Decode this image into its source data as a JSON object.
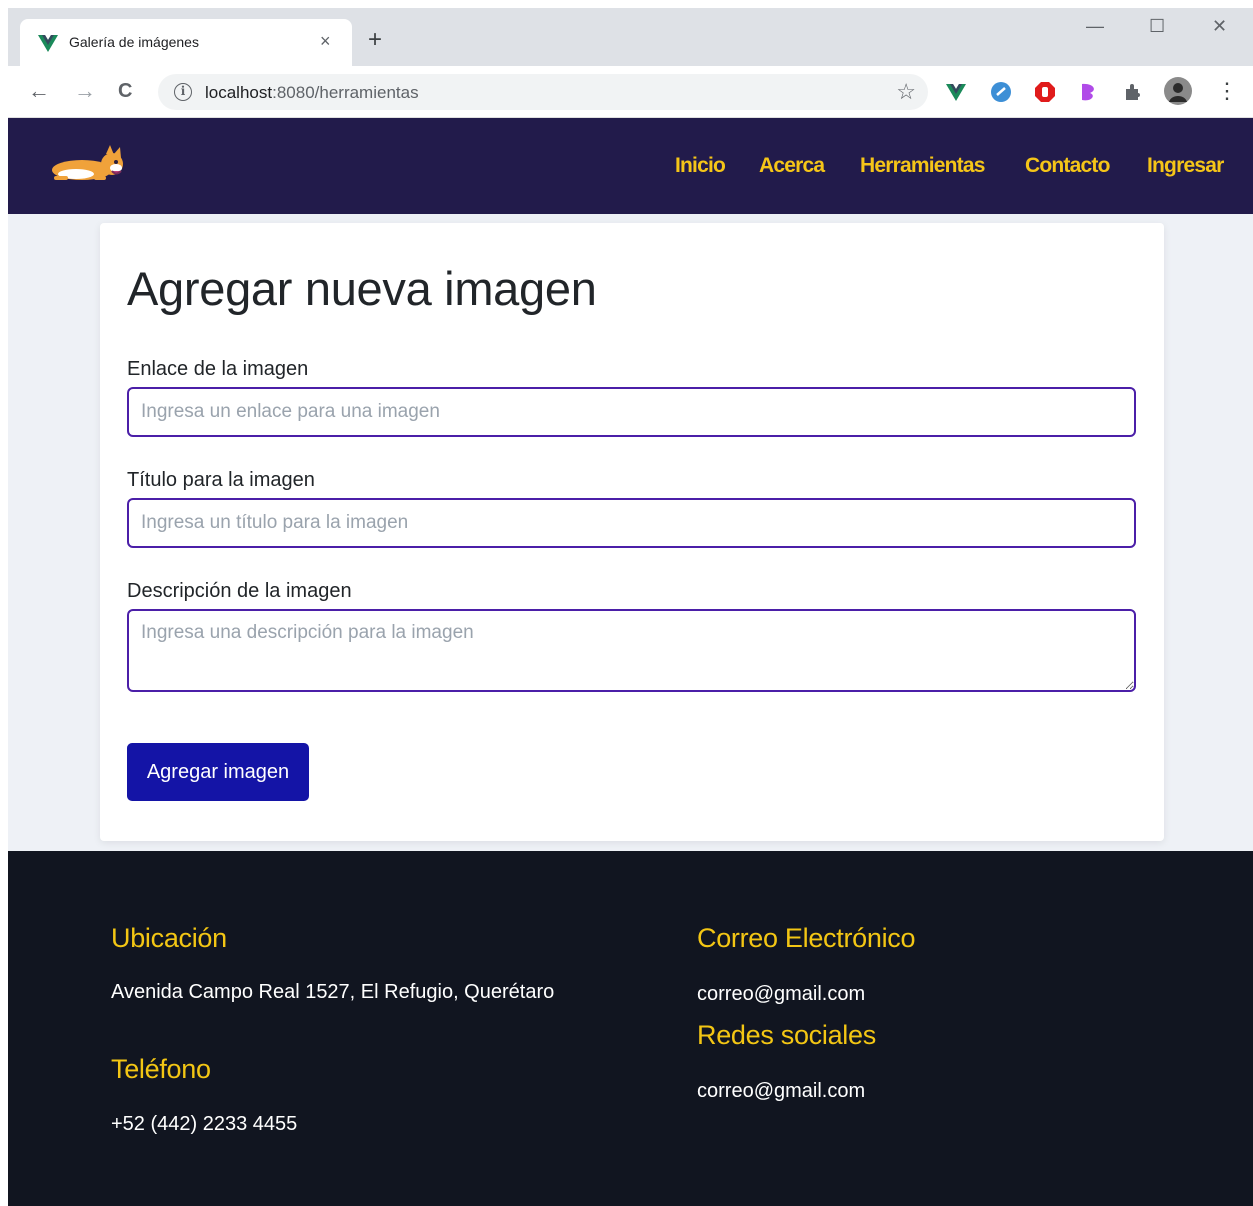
{
  "browser": {
    "tab_title": "Galería de imágenes",
    "tab_close": "×",
    "new_tab": "+",
    "url_host": "localhost",
    "url_rest": ":8080/herramientas",
    "back": "←",
    "forward": "→",
    "reload": "C",
    "info": "i",
    "star": "☆",
    "minimize": "—",
    "maximize": "☐",
    "close": "✕",
    "menu": "⋮"
  },
  "nav": {
    "links": [
      "Inicio",
      "Acerca",
      "Herramientas",
      "Contacto",
      "Ingresar"
    ]
  },
  "form": {
    "title": "Agregar nueva imagen",
    "link_label": "Enlace de la imagen",
    "link_placeholder": "Ingresa un enlace para una imagen",
    "title_label": "Título para la imagen",
    "title_placeholder": "Ingresa un título para la imagen",
    "desc_label": "Descripción de la imagen",
    "desc_placeholder": "Ingresa una descripción para la imagen",
    "submit_label": "Agregar imagen"
  },
  "footer": {
    "location_heading": "Ubicación",
    "location_text": "Avenida Campo Real 1527, El Refugio, Querétaro",
    "phone_heading": "Teléfono",
    "phone_text": "+52 (442) 2233 4455",
    "email_heading": "Correo Electrónico",
    "email_text": "correo@gmail.com",
    "social_heading": "Redes sociales",
    "social_text": "correo@gmail.com"
  },
  "colors": {
    "nav_bg": "#221b4b",
    "accent_yellow": "#f5c518",
    "field_border": "#4b1fa8",
    "button_bg": "#1414a6",
    "footer_bg": "#111520"
  }
}
